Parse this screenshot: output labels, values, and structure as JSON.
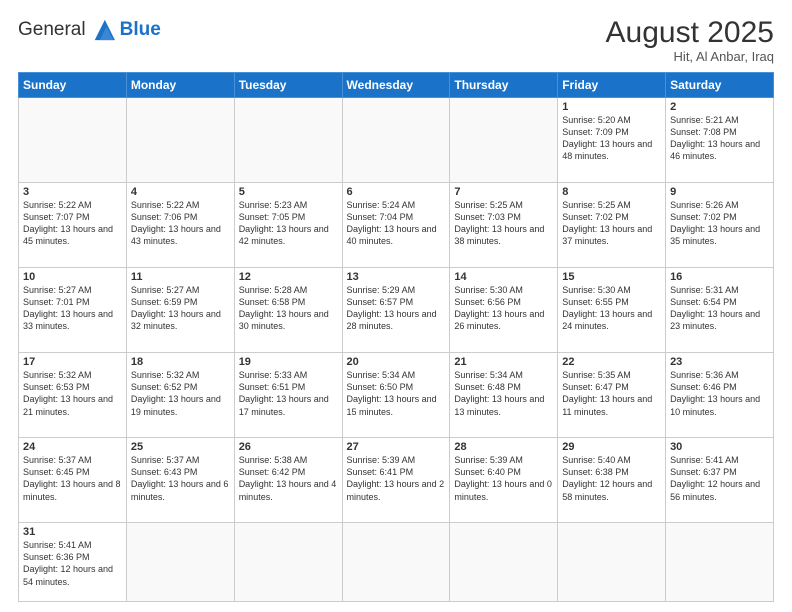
{
  "header": {
    "logo_general": "General",
    "logo_blue": "Blue",
    "month_year": "August 2025",
    "location": "Hit, Al Anbar, Iraq"
  },
  "days_of_week": [
    "Sunday",
    "Monday",
    "Tuesday",
    "Wednesday",
    "Thursday",
    "Friday",
    "Saturday"
  ],
  "weeks": [
    [
      {
        "day": "",
        "info": ""
      },
      {
        "day": "",
        "info": ""
      },
      {
        "day": "",
        "info": ""
      },
      {
        "day": "",
        "info": ""
      },
      {
        "day": "",
        "info": ""
      },
      {
        "day": "1",
        "info": "Sunrise: 5:20 AM\nSunset: 7:09 PM\nDaylight: 13 hours and 48 minutes."
      },
      {
        "day": "2",
        "info": "Sunrise: 5:21 AM\nSunset: 7:08 PM\nDaylight: 13 hours and 46 minutes."
      }
    ],
    [
      {
        "day": "3",
        "info": "Sunrise: 5:22 AM\nSunset: 7:07 PM\nDaylight: 13 hours and 45 minutes."
      },
      {
        "day": "4",
        "info": "Sunrise: 5:22 AM\nSunset: 7:06 PM\nDaylight: 13 hours and 43 minutes."
      },
      {
        "day": "5",
        "info": "Sunrise: 5:23 AM\nSunset: 7:05 PM\nDaylight: 13 hours and 42 minutes."
      },
      {
        "day": "6",
        "info": "Sunrise: 5:24 AM\nSunset: 7:04 PM\nDaylight: 13 hours and 40 minutes."
      },
      {
        "day": "7",
        "info": "Sunrise: 5:25 AM\nSunset: 7:03 PM\nDaylight: 13 hours and 38 minutes."
      },
      {
        "day": "8",
        "info": "Sunrise: 5:25 AM\nSunset: 7:02 PM\nDaylight: 13 hours and 37 minutes."
      },
      {
        "day": "9",
        "info": "Sunrise: 5:26 AM\nSunset: 7:02 PM\nDaylight: 13 hours and 35 minutes."
      }
    ],
    [
      {
        "day": "10",
        "info": "Sunrise: 5:27 AM\nSunset: 7:01 PM\nDaylight: 13 hours and 33 minutes."
      },
      {
        "day": "11",
        "info": "Sunrise: 5:27 AM\nSunset: 6:59 PM\nDaylight: 13 hours and 32 minutes."
      },
      {
        "day": "12",
        "info": "Sunrise: 5:28 AM\nSunset: 6:58 PM\nDaylight: 13 hours and 30 minutes."
      },
      {
        "day": "13",
        "info": "Sunrise: 5:29 AM\nSunset: 6:57 PM\nDaylight: 13 hours and 28 minutes."
      },
      {
        "day": "14",
        "info": "Sunrise: 5:30 AM\nSunset: 6:56 PM\nDaylight: 13 hours and 26 minutes."
      },
      {
        "day": "15",
        "info": "Sunrise: 5:30 AM\nSunset: 6:55 PM\nDaylight: 13 hours and 24 minutes."
      },
      {
        "day": "16",
        "info": "Sunrise: 5:31 AM\nSunset: 6:54 PM\nDaylight: 13 hours and 23 minutes."
      }
    ],
    [
      {
        "day": "17",
        "info": "Sunrise: 5:32 AM\nSunset: 6:53 PM\nDaylight: 13 hours and 21 minutes."
      },
      {
        "day": "18",
        "info": "Sunrise: 5:32 AM\nSunset: 6:52 PM\nDaylight: 13 hours and 19 minutes."
      },
      {
        "day": "19",
        "info": "Sunrise: 5:33 AM\nSunset: 6:51 PM\nDaylight: 13 hours and 17 minutes."
      },
      {
        "day": "20",
        "info": "Sunrise: 5:34 AM\nSunset: 6:50 PM\nDaylight: 13 hours and 15 minutes."
      },
      {
        "day": "21",
        "info": "Sunrise: 5:34 AM\nSunset: 6:48 PM\nDaylight: 13 hours and 13 minutes."
      },
      {
        "day": "22",
        "info": "Sunrise: 5:35 AM\nSunset: 6:47 PM\nDaylight: 13 hours and 11 minutes."
      },
      {
        "day": "23",
        "info": "Sunrise: 5:36 AM\nSunset: 6:46 PM\nDaylight: 13 hours and 10 minutes."
      }
    ],
    [
      {
        "day": "24",
        "info": "Sunrise: 5:37 AM\nSunset: 6:45 PM\nDaylight: 13 hours and 8 minutes."
      },
      {
        "day": "25",
        "info": "Sunrise: 5:37 AM\nSunset: 6:43 PM\nDaylight: 13 hours and 6 minutes."
      },
      {
        "day": "26",
        "info": "Sunrise: 5:38 AM\nSunset: 6:42 PM\nDaylight: 13 hours and 4 minutes."
      },
      {
        "day": "27",
        "info": "Sunrise: 5:39 AM\nSunset: 6:41 PM\nDaylight: 13 hours and 2 minutes."
      },
      {
        "day": "28",
        "info": "Sunrise: 5:39 AM\nSunset: 6:40 PM\nDaylight: 13 hours and 0 minutes."
      },
      {
        "day": "29",
        "info": "Sunrise: 5:40 AM\nSunset: 6:38 PM\nDaylight: 12 hours and 58 minutes."
      },
      {
        "day": "30",
        "info": "Sunrise: 5:41 AM\nSunset: 6:37 PM\nDaylight: 12 hours and 56 minutes."
      }
    ],
    [
      {
        "day": "31",
        "info": "Sunrise: 5:41 AM\nSunset: 6:36 PM\nDaylight: 12 hours and 54 minutes."
      },
      {
        "day": "",
        "info": ""
      },
      {
        "day": "",
        "info": ""
      },
      {
        "day": "",
        "info": ""
      },
      {
        "day": "",
        "info": ""
      },
      {
        "day": "",
        "info": ""
      },
      {
        "day": "",
        "info": ""
      }
    ]
  ]
}
